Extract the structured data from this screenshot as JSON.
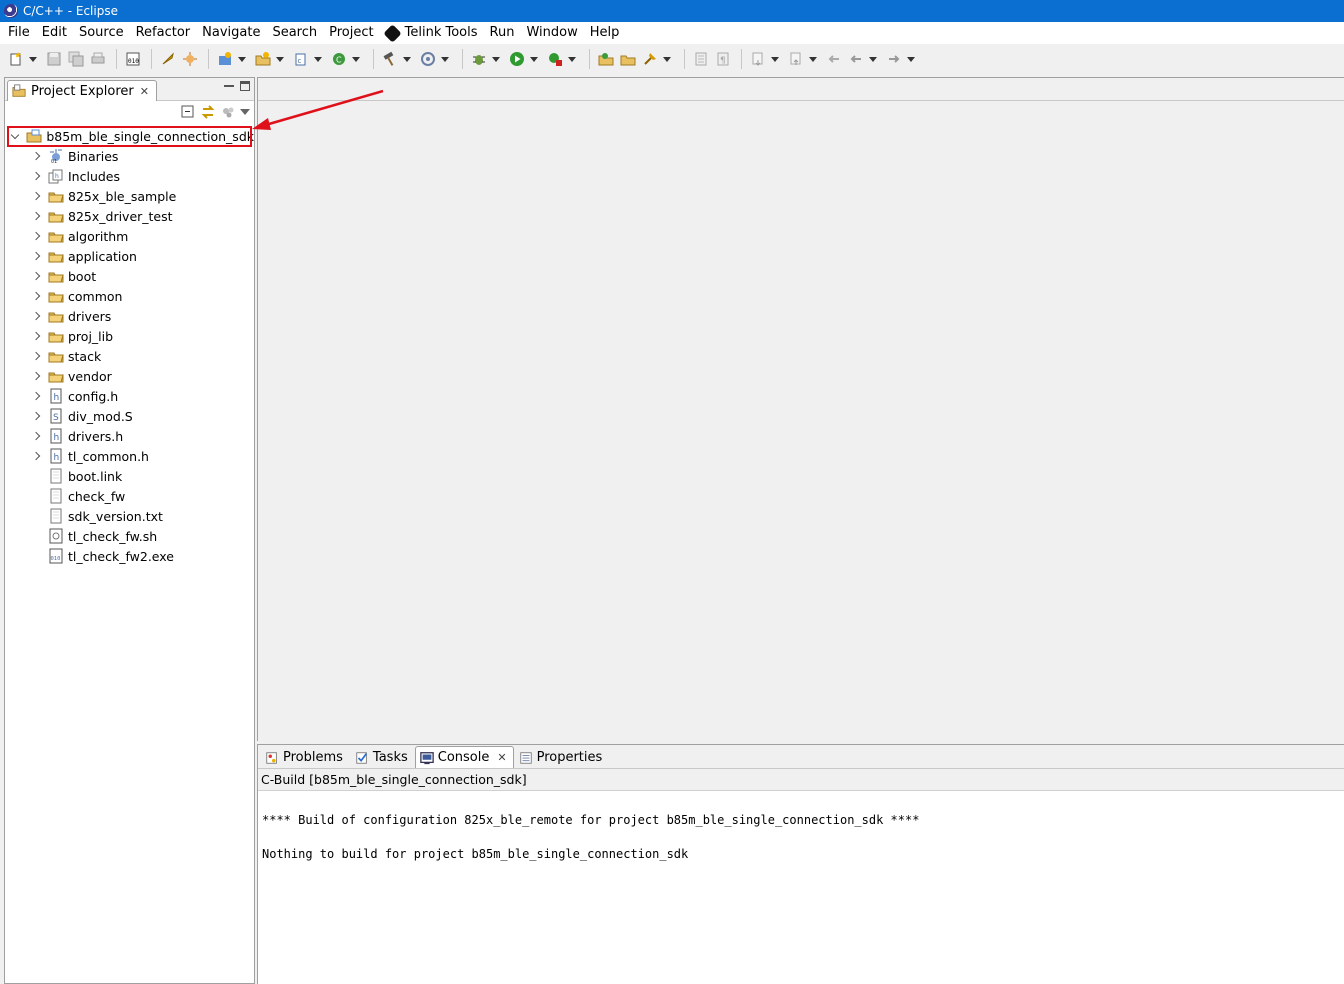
{
  "window": {
    "title": "C/C++ - Eclipse"
  },
  "menu": [
    "File",
    "Edit",
    "Source",
    "Refactor",
    "Navigate",
    "Search",
    "Project",
    "Telink Tools",
    "Run",
    "Window",
    "Help"
  ],
  "explorer": {
    "tab_label": "Project Explorer",
    "root": "b85m_ble_single_connection_sdk",
    "items": [
      {
        "label": "Binaries",
        "icon": "binaries-icon",
        "expandable": true
      },
      {
        "label": "Includes",
        "icon": "includes-icon",
        "expandable": true
      },
      {
        "label": "825x_ble_sample",
        "icon": "folder-icon",
        "expandable": true
      },
      {
        "label": "825x_driver_test",
        "icon": "folder-icon",
        "expandable": true
      },
      {
        "label": "algorithm",
        "icon": "folder-icon",
        "expandable": true
      },
      {
        "label": "application",
        "icon": "folder-icon",
        "expandable": true
      },
      {
        "label": "boot",
        "icon": "folder-icon",
        "expandable": true
      },
      {
        "label": "common",
        "icon": "folder-icon",
        "expandable": true
      },
      {
        "label": "drivers",
        "icon": "folder-icon",
        "expandable": true
      },
      {
        "label": "proj_lib",
        "icon": "folder-icon",
        "expandable": true
      },
      {
        "label": "stack",
        "icon": "folder-icon",
        "expandable": true
      },
      {
        "label": "vendor",
        "icon": "folder-icon",
        "expandable": true
      },
      {
        "label": "config.h",
        "icon": "header-file-icon",
        "expandable": true
      },
      {
        "label": "div_mod.S",
        "icon": "asm-file-icon",
        "expandable": true
      },
      {
        "label": "drivers.h",
        "icon": "header-file-icon",
        "expandable": true
      },
      {
        "label": "tl_common.h",
        "icon": "header-file-icon",
        "expandable": true
      },
      {
        "label": "boot.link",
        "icon": "text-file-icon",
        "expandable": false
      },
      {
        "label": "check_fw",
        "icon": "text-file-icon",
        "expandable": false
      },
      {
        "label": "sdk_version.txt",
        "icon": "text-file-icon",
        "expandable": false
      },
      {
        "label": "tl_check_fw.sh",
        "icon": "script-file-icon",
        "expandable": false
      },
      {
        "label": "tl_check_fw2.exe",
        "icon": "binary-file-icon",
        "expandable": false
      }
    ]
  },
  "bottom": {
    "tabs": [
      {
        "label": "Problems",
        "icon": "problems-icon",
        "active": false
      },
      {
        "label": "Tasks",
        "icon": "tasks-icon",
        "active": false
      },
      {
        "label": "Console",
        "icon": "console-icon",
        "active": true
      },
      {
        "label": "Properties",
        "icon": "properties-icon",
        "active": false
      }
    ],
    "console_title": "C-Build [b85m_ble_single_connection_sdk]",
    "lines": [
      "",
      "**** Build of configuration 825x_ble_remote for project b85m_ble_single_connection_sdk ****",
      "",
      "Nothing to build for project b85m_ble_single_connection_sdk"
    ]
  },
  "colors": {
    "titlebar": "#0a6fd1",
    "highlight": "#e0101a"
  }
}
